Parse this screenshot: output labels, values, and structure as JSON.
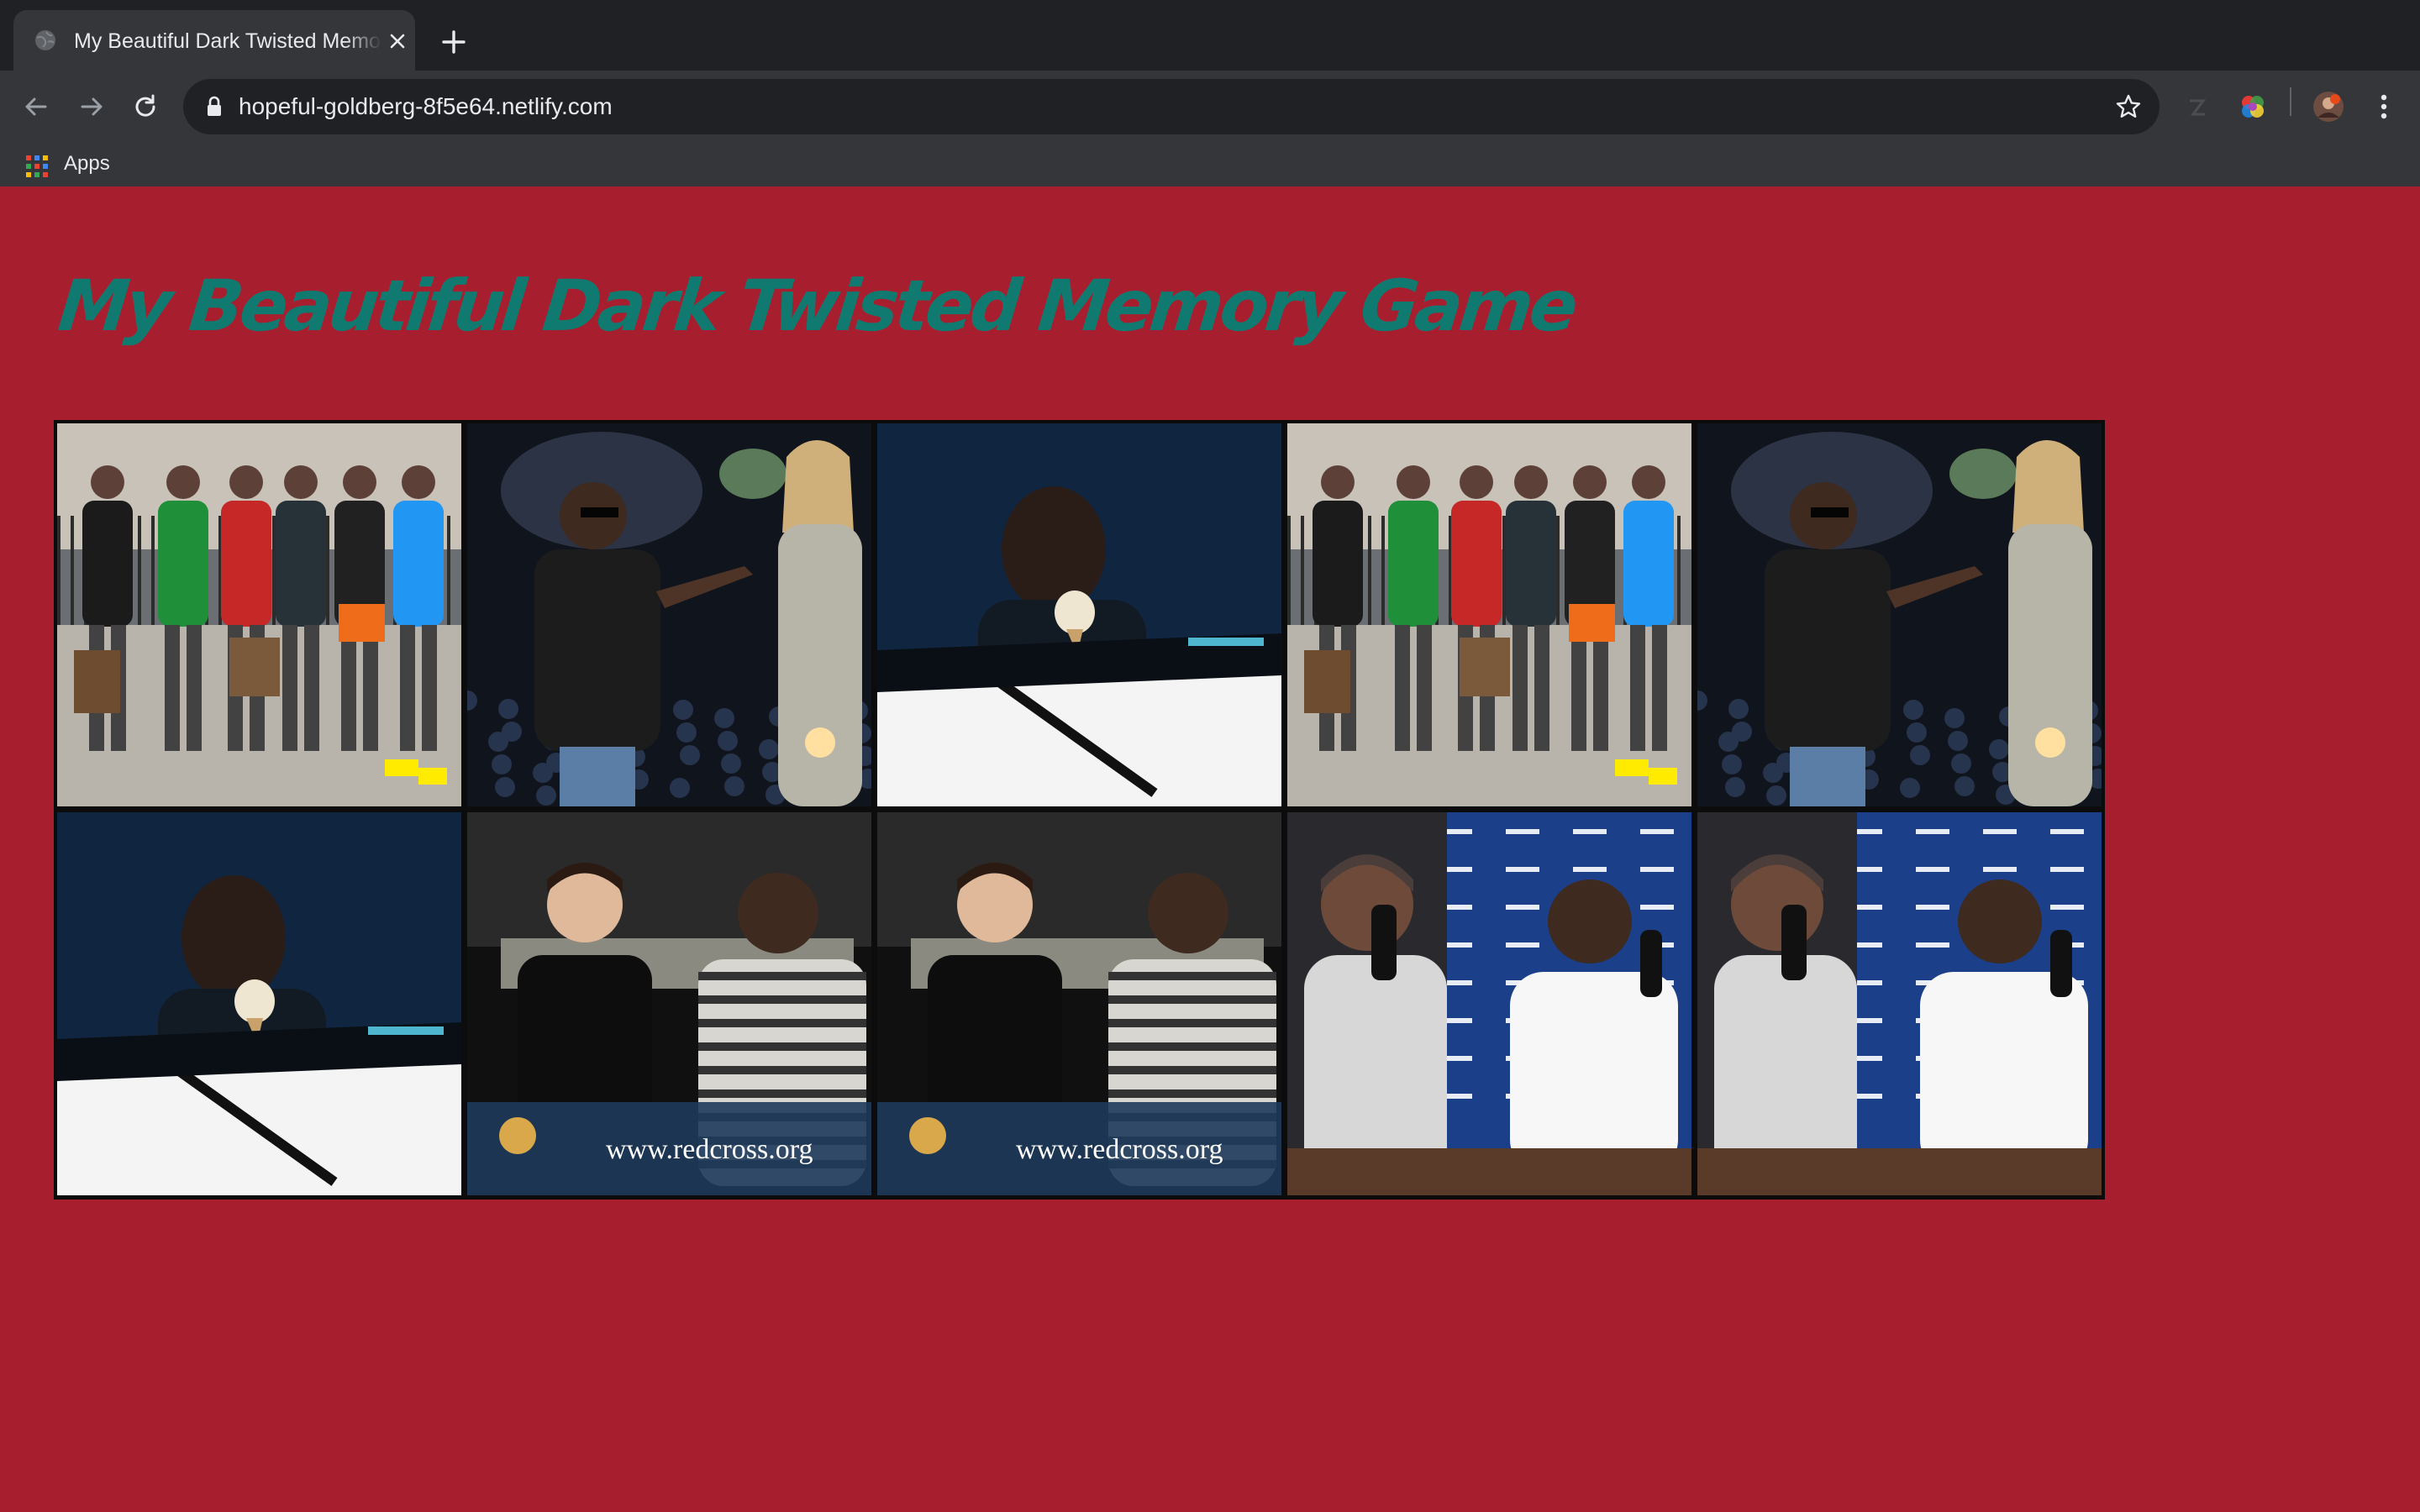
{
  "browser": {
    "tab_title": "My Beautiful Dark Twisted Memory Game",
    "url": "hopeful-goldberg-8f5e64.netlify.com",
    "bookmarks": [
      {
        "label": "Apps",
        "icon": "apps-grid-icon"
      }
    ]
  },
  "page": {
    "title": "My Beautiful Dark Twisted Memory Game",
    "background_color": "#a71f2e",
    "title_color": "#117a70"
  },
  "cards": [
    {
      "scene": "fashion-group",
      "caption": ""
    },
    {
      "scene": "stage-mic",
      "caption": ""
    },
    {
      "scene": "car-icecream",
      "caption": ""
    },
    {
      "scene": "fashion-group",
      "caption": ""
    },
    {
      "scene": "stage-mic",
      "caption": ""
    },
    {
      "scene": "car-icecream",
      "caption": ""
    },
    {
      "scene": "telethon",
      "caption": "www.redcross.org"
    },
    {
      "scene": "telethon",
      "caption": "www.redcross.org"
    },
    {
      "scene": "radio-studio",
      "caption": ""
    },
    {
      "scene": "radio-studio",
      "caption": ""
    }
  ]
}
